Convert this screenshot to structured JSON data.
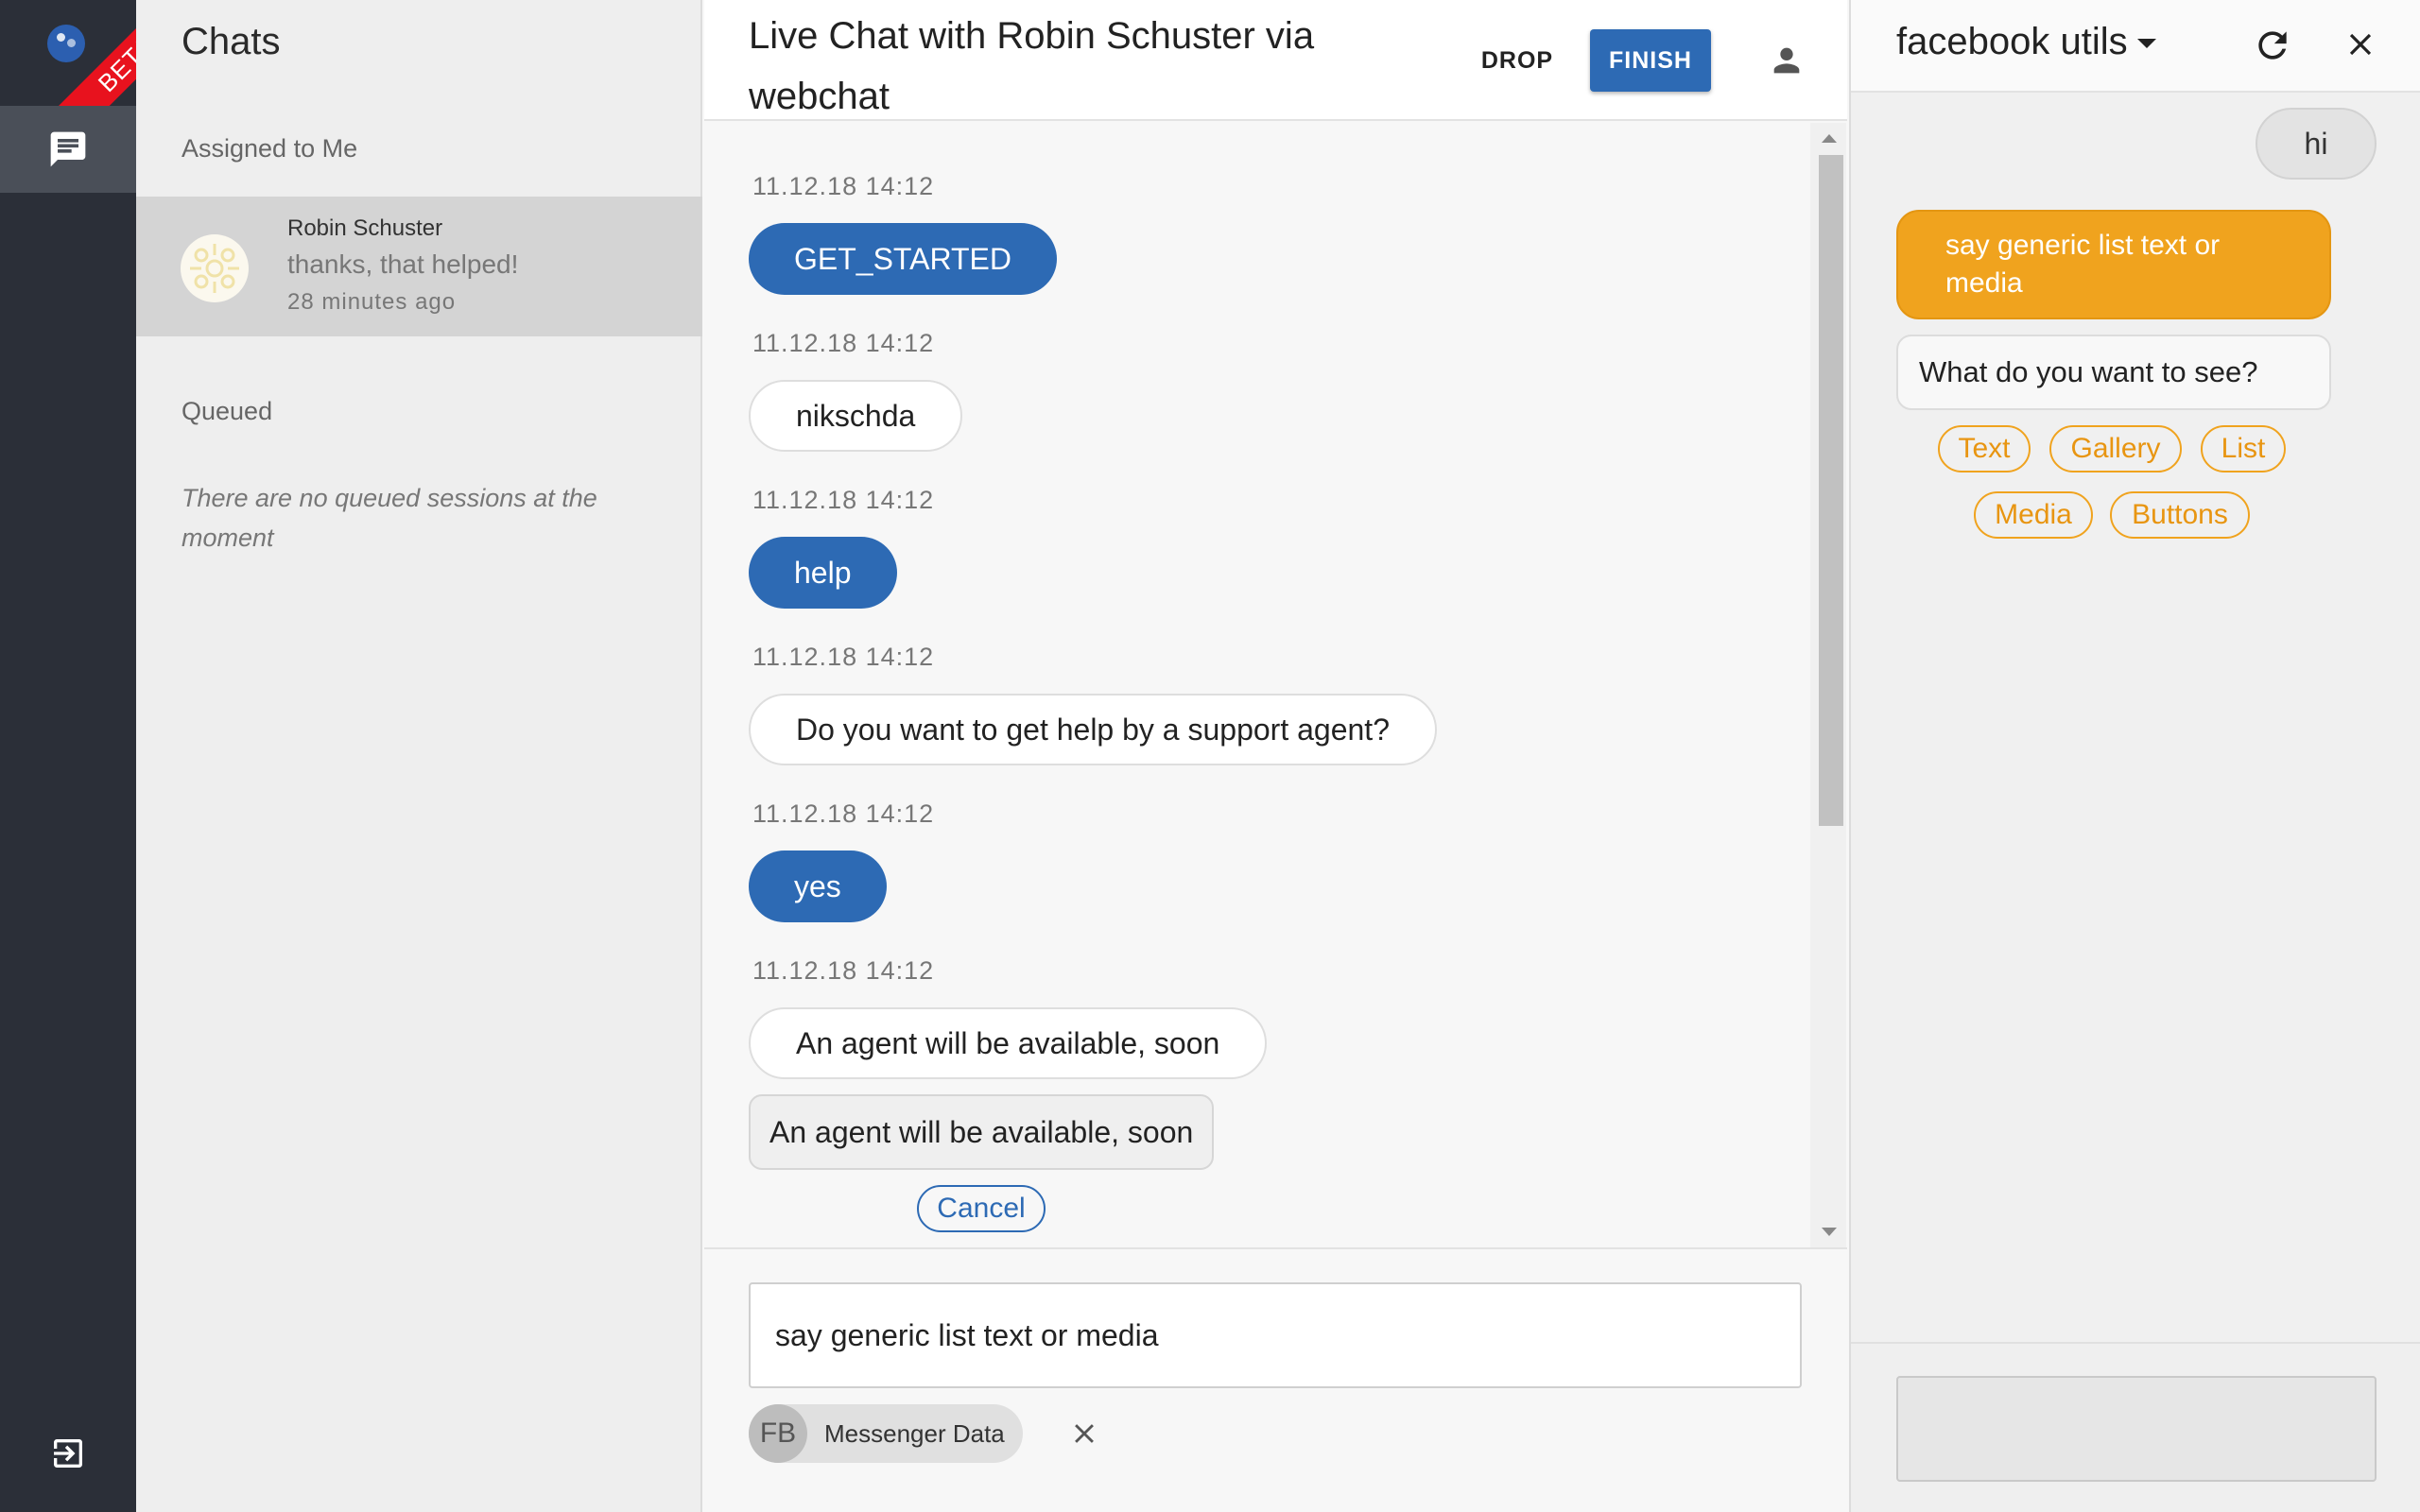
{
  "rail": {
    "badge": "BETA",
    "icons": {
      "logo": "logo-icon",
      "chats": "chat-icon",
      "logout": "logout-icon"
    }
  },
  "chats": {
    "title": "Chats",
    "assigned_title": "Assigned to Me",
    "session": {
      "name": "Robin Schuster",
      "last_message": "thanks, that helped!",
      "time": "28 minutes ago"
    },
    "queued_title": "Queued",
    "queued_empty": "There are no queued sessions at the moment"
  },
  "chat": {
    "title": "Live Chat with Robin Schuster via webchat",
    "drop_label": "DROP",
    "finish_label": "FINISH",
    "messages": [
      {
        "time": "11.12.18 14:12",
        "text": "GET_STARTED",
        "from": "user"
      },
      {
        "time": "11.12.18 14:12",
        "text": "nikschda",
        "from": "bot"
      },
      {
        "time": "11.12.18 14:12",
        "text": "help",
        "from": "user"
      },
      {
        "time": "11.12.18 14:12",
        "text": "Do you want to get help by a support agent?",
        "from": "bot"
      },
      {
        "time": "11.12.18 14:12",
        "text": "yes",
        "from": "user"
      },
      {
        "time": "11.12.18 14:12",
        "text": "An agent will be available, soon",
        "from": "bot"
      }
    ],
    "pending_message": "An agent will be available, soon",
    "cancel_label": "Cancel",
    "composer_value": "say generic list text or media",
    "chip": {
      "avatar": "FB",
      "label": "Messenger Data"
    }
  },
  "webchat": {
    "title": "facebook utils",
    "user_hi": "hi",
    "user_message": "say generic list text or media",
    "bot_question": "What do you want to see?",
    "quick_replies": [
      "Text",
      "Gallery",
      "List",
      "Media",
      "Buttons"
    ]
  },
  "colors": {
    "accent": "#2d6ab4",
    "orange": "#f0a31e",
    "rail": "#2b2f38",
    "beta": "#e8121e"
  }
}
